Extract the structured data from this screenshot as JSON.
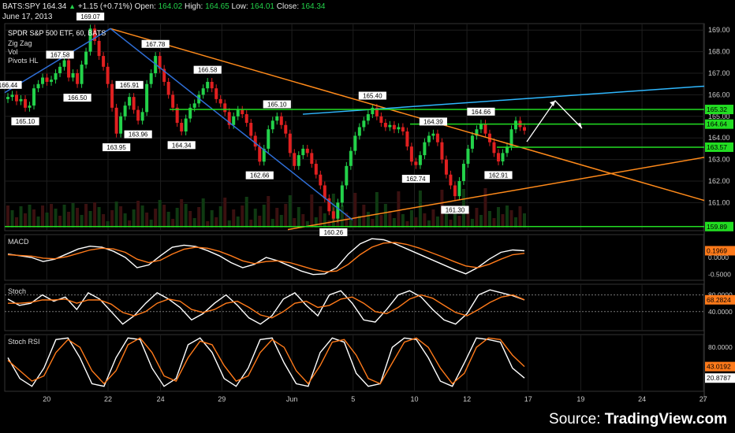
{
  "header": {
    "symbol": "BATS:SPY",
    "last": "164.34",
    "change_arrow": "▲",
    "change": "+1.15 (+0.71%)",
    "open_label": "Open:",
    "open": "164.02",
    "high_label": "High:",
    "high": "164.65",
    "low_label": "Low:",
    "low": "164.01",
    "close_label": "Close:",
    "close": "164.34",
    "date": "June 17, 2013"
  },
  "footer": {
    "source_label": "Source:",
    "brand": "TradingView.com"
  },
  "colors": {
    "bg": "#000000",
    "up": "#23d24a",
    "down": "#e02020",
    "grid": "#1e1e1e",
    "zigzag": "#ffffff",
    "orange": "#ff8a1a",
    "blue": "#2f6fd8",
    "cyan": "#2fb8ff",
    "green_line": "#22dd22",
    "macd_signal": "#ff7a1a",
    "white_line": "#ffffff"
  },
  "chart_data": [
    {
      "type": "candlestick",
      "title": "SPDR S&P 500 ETF, 60, BATS",
      "indicators": [
        "Zig Zag",
        "Vol",
        "Pivots HL"
      ],
      "ylim": [
        159.7,
        169.3
      ],
      "y_ticks": [
        "169.00",
        "168.00",
        "167.00",
        "166.00",
        "165.00",
        "164.00",
        "163.00",
        "162.00",
        "161.00"
      ],
      "x_ticks": [
        {
          "label": "20",
          "slot": 3
        },
        {
          "label": "22",
          "slot": 10
        },
        {
          "label": "24",
          "slot": 16
        },
        {
          "label": "29",
          "slot": 23
        },
        {
          "label": "Jun",
          "slot": 31
        },
        {
          "label": "5",
          "slot": 38
        },
        {
          "label": "10",
          "slot": 45
        },
        {
          "label": "12",
          "slot": 51
        },
        {
          "label": "17",
          "slot": 58
        },
        {
          "label": "19",
          "slot": 64
        },
        {
          "label": "24",
          "slot": 71
        },
        {
          "label": "27",
          "slot": 78
        }
      ],
      "closes": [
        165.9,
        166.0,
        165.7,
        165.8,
        165.4,
        165.5,
        166.3,
        166.5,
        166.8,
        166.6,
        166.7,
        167.0,
        167.3,
        167.6,
        166.8,
        167.0,
        166.5,
        167.4,
        168.0,
        169.07,
        168.5,
        167.8,
        167.3,
        166.5,
        165.4,
        164.2,
        165.0,
        165.5,
        165.9,
        165.3,
        164.8,
        165.2,
        166.5,
        167.0,
        167.8,
        167.2,
        166.6,
        166.0,
        165.4,
        164.7,
        164.3,
        164.9,
        165.4,
        165.6,
        166.0,
        166.3,
        166.6,
        166.3,
        165.8,
        165.6,
        165.2,
        164.6,
        165.0,
        165.3,
        165.1,
        164.7,
        164.1,
        163.6,
        162.9,
        163.5,
        164.4,
        164.8,
        165.0,
        164.6,
        164.2,
        163.3,
        162.7,
        163.2,
        163.5,
        163.3,
        162.8,
        162.3,
        161.8,
        161.2,
        160.6,
        160.26,
        161.0,
        161.8,
        162.7,
        163.4,
        164.1,
        164.5,
        164.8,
        165.1,
        165.4,
        165.0,
        164.7,
        164.5,
        164.6,
        164.4,
        164.5,
        164.3,
        163.6,
        162.9,
        162.74,
        163.2,
        163.8,
        164.1,
        164.2,
        163.8,
        163.0,
        162.3,
        161.8,
        161.3,
        162.0,
        162.8,
        163.5,
        164.1,
        164.4,
        164.66,
        164.2,
        163.8,
        163.3,
        162.91,
        163.3,
        163.6,
        164.4,
        164.8,
        164.5,
        164.34
      ],
      "pivot_labels": [
        {
          "text": "166.44",
          "i": 0,
          "pos": "above"
        },
        {
          "text": "165.10",
          "i": 4,
          "pos": "below"
        },
        {
          "text": "167.58",
          "i": 12,
          "pos": "above"
        },
        {
          "text": "166.50",
          "i": 16,
          "pos": "below"
        },
        {
          "text": "169.07",
          "i": 19,
          "pos": "above"
        },
        {
          "text": "163.95",
          "i": 25,
          "pos": "below"
        },
        {
          "text": "165.91",
          "i": 28,
          "pos": "above"
        },
        {
          "text": "163.96",
          "i": 30,
          "pos": "below"
        },
        {
          "text": "167.78",
          "i": 34,
          "pos": "above"
        },
        {
          "text": "164.34",
          "i": 40,
          "pos": "below"
        },
        {
          "text": "166.58",
          "i": 46,
          "pos": "above"
        },
        {
          "text": "162.66",
          "i": 58,
          "pos": "below"
        },
        {
          "text": "165.10",
          "i": 62,
          "pos": "above"
        },
        {
          "text": "160.26",
          "i": 75,
          "pos": "below"
        },
        {
          "text": "165.40",
          "i": 84,
          "pos": "above"
        },
        {
          "text": "162.74",
          "i": 94,
          "pos": "below"
        },
        {
          "text": "164.39",
          "i": 98,
          "pos": "above"
        },
        {
          "text": "161.30",
          "i": 103,
          "pos": "below"
        },
        {
          "text": "164.66",
          "i": 109,
          "pos": "above"
        },
        {
          "text": "162.91",
          "i": 113,
          "pos": "below"
        }
      ],
      "right_markers": [
        {
          "text": "165.32",
          "value": 165.32,
          "color": "#22dd22"
        },
        {
          "text": "164.64",
          "value": 164.64,
          "color": "#22dd22"
        },
        {
          "text": "163.57",
          "value": 163.57,
          "color": "#22dd22"
        },
        {
          "text": "159.89",
          "value": 159.89,
          "color": "#22dd22"
        }
      ]
    },
    {
      "type": "line",
      "title": "MACD",
      "ylim": [
        -0.6,
        0.6
      ],
      "y_ticks": [
        "0.0000",
        "-0.5000"
      ],
      "series": [
        {
          "name": "MACD",
          "color": "#ffffff",
          "values": [
            0.1,
            0.05,
            0.0,
            -0.12,
            -0.05,
            0.1,
            0.25,
            0.33,
            0.3,
            0.18,
            0.0,
            -0.3,
            -0.22,
            0.05,
            0.3,
            0.36,
            0.32,
            0.2,
            0.05,
            -0.15,
            -0.3,
            -0.2,
            0.0,
            -0.1,
            -0.25,
            -0.4,
            -0.5,
            -0.48,
            -0.3,
            0.1,
            0.4,
            0.55,
            0.52,
            0.4,
            0.25,
            0.1,
            -0.05,
            -0.2,
            -0.35,
            -0.48,
            -0.3,
            -0.05,
            0.15,
            0.22,
            0.1969
          ]
        },
        {
          "name": "Signal",
          "color": "#ff7a1a",
          "values": [
            0.08,
            0.06,
            0.04,
            -0.02,
            -0.04,
            0.02,
            0.12,
            0.22,
            0.27,
            0.25,
            0.15,
            -0.05,
            -0.15,
            -0.08,
            0.1,
            0.24,
            0.3,
            0.27,
            0.18,
            0.05,
            -0.1,
            -0.18,
            -0.12,
            -0.1,
            -0.15,
            -0.25,
            -0.35,
            -0.42,
            -0.4,
            -0.2,
            0.08,
            0.3,
            0.42,
            0.44,
            0.38,
            0.28,
            0.15,
            0.02,
            -0.12,
            -0.25,
            -0.3,
            -0.2,
            -0.05,
            0.08,
            0.12
          ]
        }
      ],
      "markers": [
        {
          "text": "0.1969",
          "value": 0.1969,
          "color": "#ff7a1a"
        }
      ]
    },
    {
      "type": "line",
      "title": "Stoch",
      "ylim": [
        0,
        100
      ],
      "y_ticks": [
        "80.0000",
        "40.0000"
      ],
      "series": [
        {
          "name": "%K",
          "color": "#ffffff",
          "values": [
            70,
            55,
            60,
            80,
            65,
            75,
            45,
            85,
            70,
            40,
            10,
            30,
            60,
            85,
            70,
            50,
            20,
            35,
            60,
            80,
            55,
            25,
            10,
            30,
            70,
            85,
            55,
            30,
            80,
            90,
            60,
            20,
            15,
            45,
            80,
            90,
            75,
            45,
            20,
            10,
            35,
            80,
            92,
            85,
            78,
            68
          ]
        },
        {
          "name": "%D",
          "color": "#ff7a1a",
          "values": [
            60,
            60,
            62,
            68,
            68,
            70,
            60,
            68,
            68,
            58,
            38,
            30,
            40,
            60,
            70,
            65,
            45,
            38,
            45,
            60,
            65,
            50,
            32,
            25,
            40,
            60,
            65,
            50,
            55,
            70,
            75,
            60,
            40,
            35,
            50,
            70,
            80,
            72,
            55,
            38,
            30,
            45,
            62,
            75,
            80,
            68.2824
          ]
        }
      ],
      "markers": [
        {
          "text": "68.2824",
          "value": 68.2824,
          "color": "#ff7a1a"
        }
      ]
    },
    {
      "type": "line",
      "title": "Stoch RSI",
      "ylim": [
        0,
        100
      ],
      "y_ticks": [
        "80.0000"
      ],
      "series": [
        {
          "name": "K",
          "color": "#ffffff",
          "values": [
            60,
            20,
            5,
            40,
            95,
            98,
            60,
            10,
            5,
            60,
            98,
            95,
            40,
            5,
            20,
            85,
            98,
            70,
            20,
            5,
            40,
            95,
            98,
            50,
            10,
            5,
            70,
            98,
            90,
            30,
            5,
            10,
            80,
            98,
            95,
            60,
            15,
            5,
            50,
            98,
            95,
            90,
            40,
            20.8787
          ]
        },
        {
          "name": "D",
          "color": "#ff7a1a",
          "values": [
            55,
            35,
            15,
            25,
            70,
            95,
            80,
            35,
            10,
            35,
            85,
            98,
            70,
            25,
            15,
            60,
            92,
            85,
            45,
            15,
            25,
            70,
            95,
            80,
            35,
            10,
            45,
            90,
            95,
            65,
            20,
            10,
            50,
            90,
            98,
            80,
            40,
            10,
            30,
            80,
            98,
            95,
            65,
            43.0192
          ]
        }
      ],
      "markers": [
        {
          "text": "43.0192",
          "value": 43.0192,
          "color": "#ff7a1a"
        },
        {
          "text": "20.8787",
          "value": 20.8787,
          "color": "#ffffff"
        }
      ]
    }
  ]
}
